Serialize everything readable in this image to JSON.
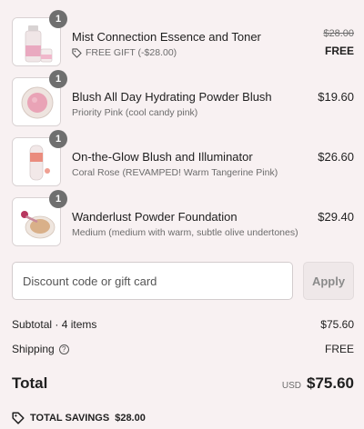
{
  "items": [
    {
      "quantity": "1",
      "title": "Mist Connection Essence and Toner",
      "subtitle": "FREE GIFT (-$28.00)",
      "original_price": "$28.00",
      "price": "FREE",
      "icon": "tag-icon"
    },
    {
      "quantity": "1",
      "title": "Blush All Day Hydrating Powder Blush",
      "subtitle": "Priority Pink (cool candy pink)",
      "price": "$19.60"
    },
    {
      "quantity": "1",
      "title": "On-the-Glow Blush and Illuminator",
      "subtitle": "Coral Rose (REVAMPED! Warm Tangerine Pink)",
      "price": "$26.60"
    },
    {
      "quantity": "1",
      "title": "Wanderlust Powder Foundation",
      "subtitle": "Medium (medium with warm, subtle olive undertones)",
      "price": "$29.40"
    }
  ],
  "discount": {
    "placeholder": "Discount code or gift card",
    "apply_label": "Apply"
  },
  "summary": {
    "subtotal_label": "Subtotal · 4 items",
    "subtotal_value": "$75.60",
    "shipping_label": "Shipping",
    "shipping_value": "FREE",
    "total_label": "Total",
    "currency": "USD",
    "total_value": "$75.60",
    "savings_label": "TOTAL SAVINGS",
    "savings_value": "$28.00"
  },
  "colors": {
    "background": "#f8f1f2",
    "badge": "#6f6f6f",
    "text": "#1f1f1f",
    "muted": "#6c6c6c"
  }
}
